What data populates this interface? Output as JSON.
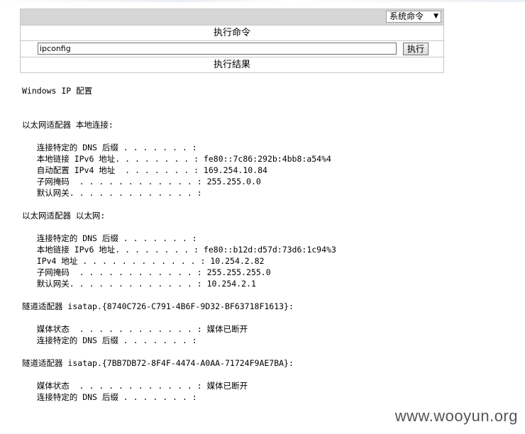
{
  "toolbar": {
    "select_value": "系统命令",
    "select_arrow": "▼"
  },
  "command": {
    "header": "执行命令",
    "input_value": "ipconfig",
    "button_label": "执行"
  },
  "result": {
    "header": "执行结果",
    "output": "Windows IP 配置\n\n\n以太网适配器 本地连接:\n\n   连接特定的 DNS 后缀 . . . . . . . :\n   本地链接 IPv6 地址. . . . . . . . : fe80::7c86:292b:4bb8:a54%4\n   自动配置 IPv4 地址  . . . . . . . : 169.254.10.84\n   子网掩码  . . . . . . . . . . . . : 255.255.0.0\n   默认网关. . . . . . . . . . . . . :\n\n以太网适配器 以太网:\n\n   连接特定的 DNS 后缀 . . . . . . . :\n   本地链接 IPv6 地址. . . . . . . . : fe80::b12d:d57d:73d6:1c94%3\n   IPv4 地址 . . . . . . . . . . . . : 10.254.2.82\n   子网掩码  . . . . . . . . . . . . : 255.255.255.0\n   默认网关. . . . . . . . . . . . . : 10.254.2.1\n\n隧道适配器 isatap.{8740C726-C791-4B6F-9D32-BF63718F1613}:\n\n   媒体状态  . . . . . . . . . . . . : 媒体已断开\n   连接特定的 DNS 后缀 . . . . . . . :\n\n隧道适配器 isatap.{7BB7DB72-8F4F-4474-A0AA-71724F9AE7BA}:\n\n   媒体状态  . . . . . . . . . . . . : 媒体已断开\n   连接特定的 DNS 后缀 . . . . . . . :"
  },
  "watermark": "www.wooyun.org"
}
